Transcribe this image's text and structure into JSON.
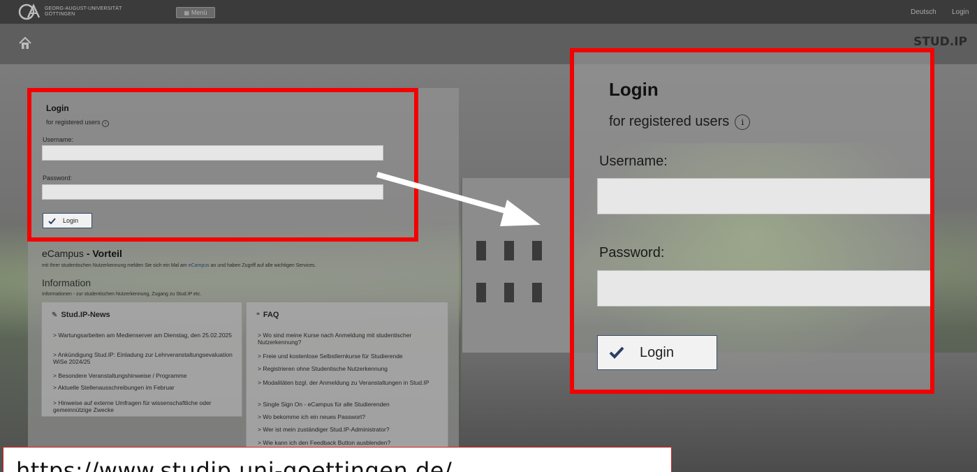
{
  "topbar": {
    "logo_text_line1": "GEORG-AUGUST-UNIVERSITÄT",
    "logo_text_line2": "GÖTTINGEN",
    "menu_label": "Menü",
    "language": "Deutsch",
    "login_link": "Login"
  },
  "brand": "STUD.IP",
  "login": {
    "title": "Login",
    "subtitle": "for registered users",
    "username_label": "Username:",
    "password_label": "Password:",
    "button_label": "Login"
  },
  "ecampus": {
    "title_a": "eCampus",
    "title_b": "- Vorteil",
    "desc_pre": "mit Ihrer studentischen Nutzerkennung melden Sie sich ein Mal am ",
    "desc_link": "eCampus",
    "desc_post": " an und haben Zugriff auf alle wichtigen Services."
  },
  "information": {
    "title": "Information",
    "desc": "Informationen - zur studentischen Nutzerkennung, Zugang zu Stud.IP etc."
  },
  "news": {
    "title": "Stud.IP-News",
    "items": [
      "> Wartungsarbeiten am Medienserver am Dienstag, den 25.02.2025",
      "> Ankündigung Stud.IP: Einladung zur Lehrveranstaltungsevaluation WiSe 2024/25",
      "> Besondere Veranstaltungshinweise / Programme",
      "> Aktuelle Stellenausschreibungen im Februar",
      "> Hinweise auf externe Umfragen für wissenschaftliche oder gemeinnützige Zwecke"
    ]
  },
  "faq": {
    "title": "FAQ",
    "items": [
      "> Wo sind meine Kurse nach Anmeldung mit studentischer Nutzerkennung?",
      "> Freie und kostenlose Selbstlernkurse für Studierende",
      "> Registrieren ohne Studentische Nutzerkennung",
      "> Modalitäten bzgl. der Anmeldung zu Veranstaltungen in Stud.IP",
      "> Single Sign On - eCampus für alle Studierenden",
      "> Wo bekomme ich ein neues Passwort?",
      "> Wer ist mein zuständiger Stud.IP-Administrator?",
      "> Wie kann ich den Feedback Button ausblenden?"
    ]
  },
  "url": "https://www.studip.uni-goettingen.de/",
  "colors": {
    "highlight": "#f30000",
    "button_border": "#354a6e",
    "topbar": "#3b3b3b"
  }
}
